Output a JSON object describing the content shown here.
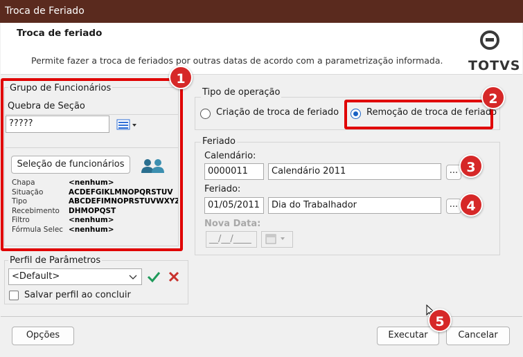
{
  "window": {
    "title": "Troca de Feriado"
  },
  "header": {
    "title": "Troca de feriado",
    "description": "Permite fazer a troca de feriados por outras datas de acordo com a parametrização informada.",
    "logo_text": "TOTVS"
  },
  "grupo": {
    "legend": "Grupo de Funcionários",
    "quebra_label": "Quebra de Seção",
    "quebra_value": "?????",
    "selection_button": "Seleção de funcionários",
    "info": [
      {
        "label": "Chapa",
        "value": "<nenhum>"
      },
      {
        "label": "Situação",
        "value": "ACDEFGIKLMNOPQRSTUV"
      },
      {
        "label": "Tipo",
        "value": "ABCDEFIMNOPRSTUVWXYZ"
      },
      {
        "label": "Recebimento",
        "value": "DHMOPQST"
      },
      {
        "label": "Filtro",
        "value": "<nenhum>"
      },
      {
        "label": "Fórmula Selec",
        "value": "<nenhum>"
      }
    ]
  },
  "perfil": {
    "legend": "Perfil de Parâmetros",
    "selected": "<Default>",
    "save_label": "Salvar perfil ao concluir"
  },
  "tipo_operacao": {
    "legend": "Tipo de operação",
    "option_criacao": "Criação de troca de feriado",
    "option_remocao": "Remoção de troca de feriado",
    "selected": "remocao"
  },
  "feriado": {
    "legend": "Feriado",
    "calendario_label": "Calendário:",
    "calendario_code": "0000011",
    "calendario_name": "Calendário 2011",
    "feriado_label": "Feriado:",
    "feriado_date": "01/05/2011",
    "feriado_name": "Dia do Trabalhador",
    "nova_data_label": "Nova Data:",
    "nova_data_value": "__/__/____",
    "lookup_label": "..."
  },
  "footer": {
    "opcoes": "Opções",
    "executar": "Executar",
    "cancelar": "Cancelar"
  },
  "badges": [
    "1",
    "2",
    "3",
    "4",
    "5"
  ],
  "colors": {
    "titlebar": "#5a2a1e",
    "annotation_red": "#d62828",
    "radio_selected": "#1a62c4",
    "confirm_green": "#1e9a5a",
    "delete_red": "#c8312c"
  }
}
